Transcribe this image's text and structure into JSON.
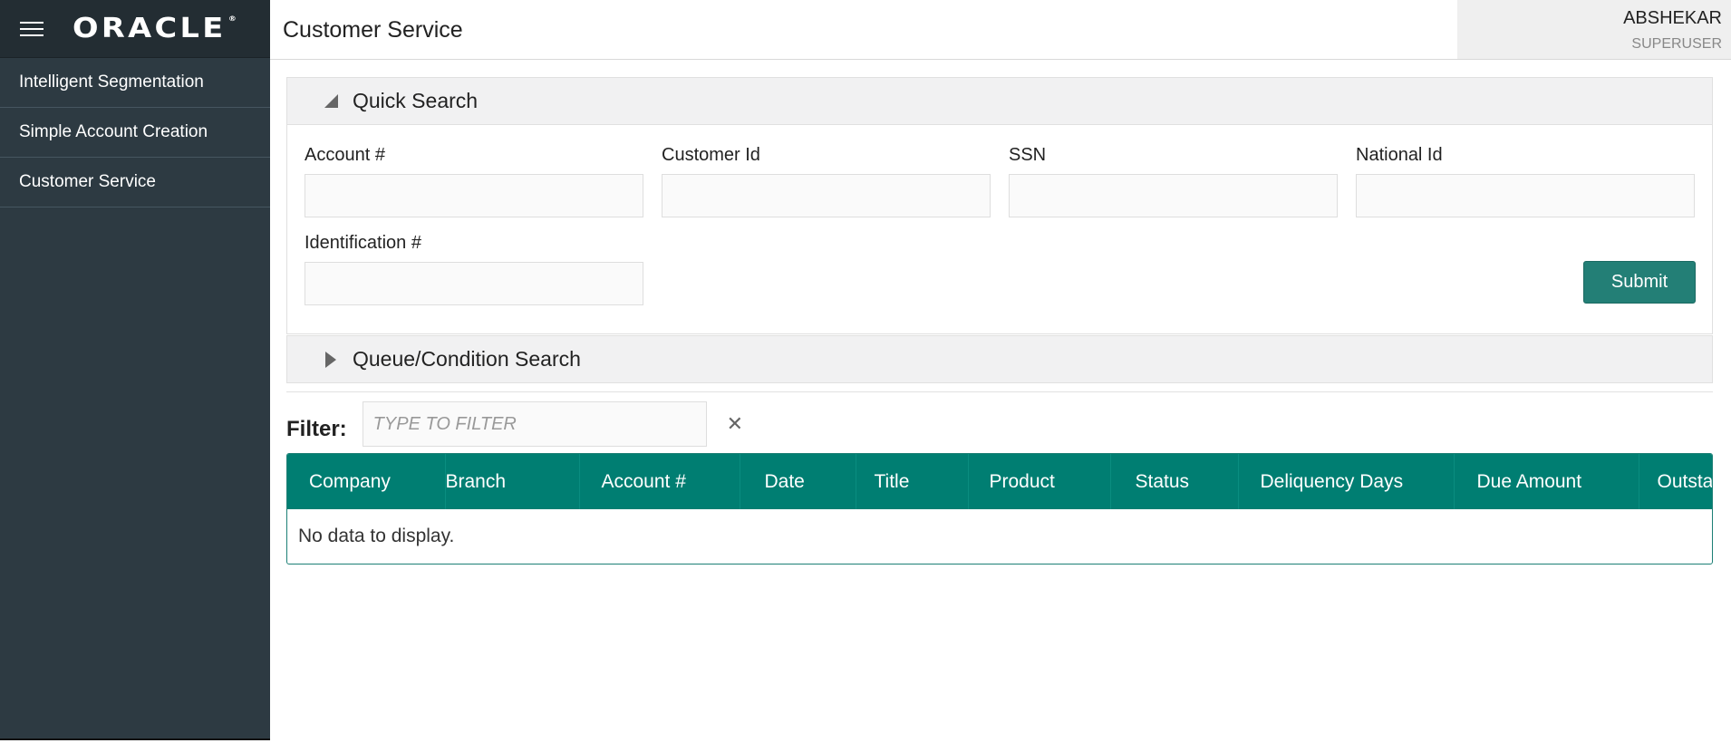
{
  "brand": {
    "logo_text": "ORACLE",
    "logo_mark": "®",
    "menu_icon": "hamburger-icon"
  },
  "sidebar": {
    "items": [
      {
        "label": "Intelligent Segmentation"
      },
      {
        "label": "Simple Account Creation"
      },
      {
        "label": "Customer Service"
      }
    ]
  },
  "header": {
    "title": "Customer Service",
    "user_name": "ABSHEKAR",
    "user_role": "SUPERUSER"
  },
  "quick_search": {
    "title": "Quick Search",
    "icon": "triangle-down-icon",
    "fields": [
      {
        "label": "Account #",
        "value": "",
        "placeholder": ""
      },
      {
        "label": "Customer Id",
        "value": "",
        "placeholder": ""
      },
      {
        "label": "SSN",
        "value": "",
        "placeholder": ""
      },
      {
        "label": "National Id",
        "value": "",
        "placeholder": ""
      },
      {
        "label": "Identification #",
        "value": "",
        "placeholder": ""
      }
    ],
    "submit_label": "Submit"
  },
  "queue_search": {
    "title": "Queue/Condition Search",
    "icon": "triangle-right-icon"
  },
  "filter": {
    "label": "Filter:",
    "placeholder": "TYPE TO FILTER",
    "clear_icon": "close-icon",
    "clear_glyph": "✕"
  },
  "table": {
    "columns": [
      "Company",
      "Branch",
      "Account #",
      "Date",
      "Title",
      "Product",
      "Status",
      "Deliquency Days",
      "Due Amount",
      "Outsta"
    ],
    "empty_message": "No data to display."
  },
  "colors": {
    "sidebar_bg": "#2d3a42",
    "brand_bg": "#232d33",
    "accent": "#007e72",
    "submit_bg": "#237f76"
  }
}
